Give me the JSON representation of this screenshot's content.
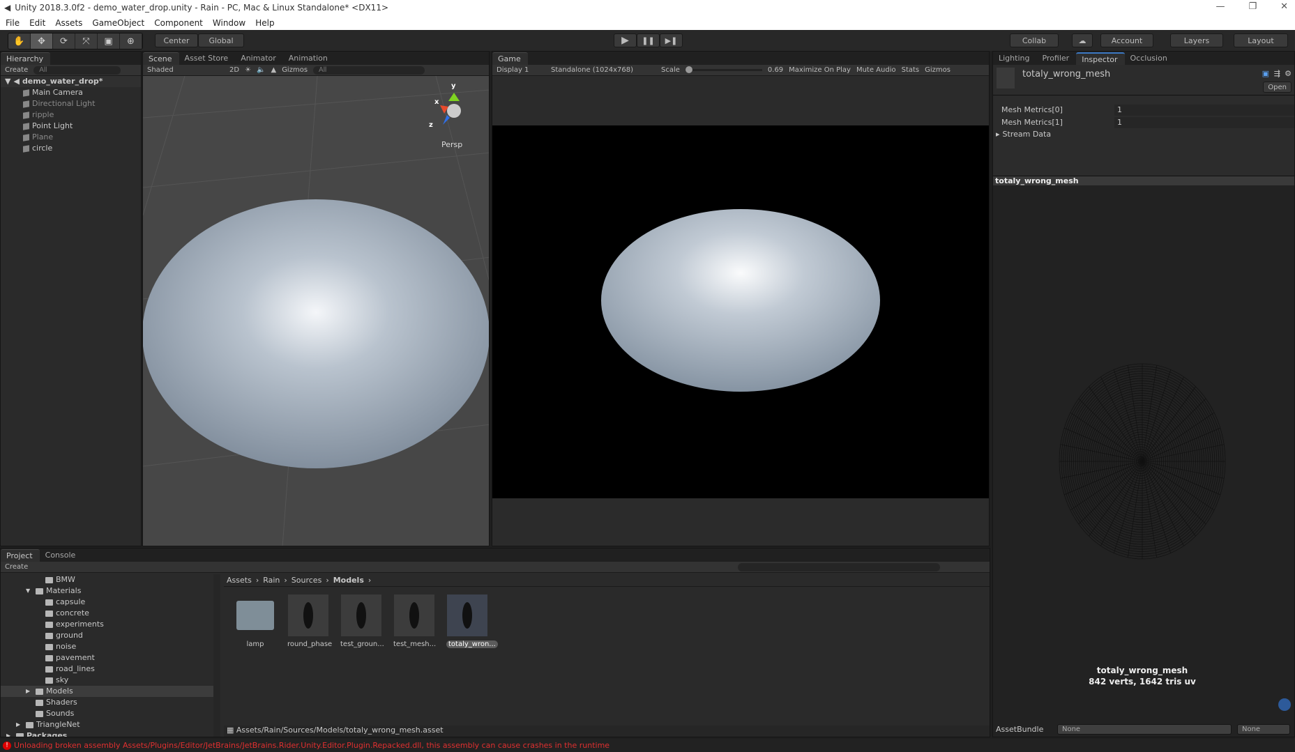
{
  "window": {
    "title": "Unity 2018.3.0f2 - demo_water_drop.unity - Rain - PC, Mac & Linux Standalone* <DX11>",
    "controls": [
      "—",
      "❐",
      "✕"
    ]
  },
  "menu": [
    "File",
    "Edit",
    "Assets",
    "GameObject",
    "Component",
    "Window",
    "Help"
  ],
  "toolbar": {
    "tools": [
      "✋",
      "✥",
      "⟳",
      "⤧",
      "▣",
      "⊕"
    ],
    "pivot": "Center",
    "space": "Global",
    "play": "▶",
    "pause": "❚❚",
    "step": "▶❚",
    "collab": "Collab",
    "account": "Account",
    "layers": "Layers",
    "layout": "Layout"
  },
  "hierarchy": {
    "tab": "Hierarchy",
    "create": "Create",
    "search_placeholder": "All",
    "scene": "demo_water_drop*",
    "items": [
      {
        "label": "Main Camera",
        "active": true
      },
      {
        "label": "Directional Light",
        "active": false
      },
      {
        "label": "ripple",
        "active": false
      },
      {
        "label": "Point Light",
        "active": true
      },
      {
        "label": "Plane",
        "active": false
      },
      {
        "label": "circle",
        "active": true
      }
    ]
  },
  "scene": {
    "tabs": [
      "Scene",
      "Asset Store",
      "Animator",
      "Animation"
    ],
    "shading": "Shaded",
    "mode2d": "2D",
    "gizmos": "Gizmos",
    "search_placeholder": "All",
    "persp": "Persp",
    "axes": {
      "x": "x",
      "y": "y",
      "z": "z"
    }
  },
  "game": {
    "tab": "Game",
    "display": "Display 1",
    "resolution": "Standalone (1024x768)",
    "scale_label": "Scale",
    "scale_value": "0.69",
    "maximize": "Maximize On Play",
    "mute": "Mute Audio",
    "stats": "Stats",
    "gizmos": "Gizmos"
  },
  "inspector": {
    "tabs": [
      "Lighting",
      "Profiler",
      "Inspector",
      "Occlusion"
    ],
    "asset_name": "totaly_wrong_mesh",
    "open": "Open",
    "fields": [
      {
        "label": "Mesh Metrics[0]",
        "value": "1"
      },
      {
        "label": "Mesh Metrics[1]",
        "value": "1"
      }
    ],
    "stream_data": "Stream Data",
    "preview_title": "totaly_wrong_mesh",
    "preview_name": "totaly_wrong_mesh",
    "preview_stats": "842 verts, 1642 tris   uv",
    "assetbundle_label": "AssetBundle",
    "assetbundle_value": "None",
    "variant_value": "None"
  },
  "project": {
    "tabs": [
      "Project",
      "Console"
    ],
    "create": "Create",
    "tree": [
      {
        "label": "BMW",
        "indent": 3
      },
      {
        "label": "Materials",
        "indent": 2,
        "expanded": true
      },
      {
        "label": "capsule",
        "indent": 3
      },
      {
        "label": "concrete",
        "indent": 3
      },
      {
        "label": "experiments",
        "indent": 3
      },
      {
        "label": "ground",
        "indent": 3
      },
      {
        "label": "noise",
        "indent": 3
      },
      {
        "label": "pavement",
        "indent": 3
      },
      {
        "label": "road_lines",
        "indent": 3
      },
      {
        "label": "sky",
        "indent": 3
      },
      {
        "label": "Models",
        "indent": 2,
        "selected": true
      },
      {
        "label": "Shaders",
        "indent": 2
      },
      {
        "label": "Sounds",
        "indent": 2
      },
      {
        "label": "TriangleNet",
        "indent": 1
      },
      {
        "label": "Packages",
        "indent": 0,
        "bold": true
      }
    ],
    "breadcrumb": [
      "Assets",
      "Rain",
      "Sources",
      "Models"
    ],
    "assets": [
      {
        "label": "lamp",
        "type": "folder"
      },
      {
        "label": "round_phase",
        "type": "mesh"
      },
      {
        "label": "test_groun...",
        "type": "mesh"
      },
      {
        "label": "test_mesh...",
        "type": "mesh"
      },
      {
        "label": "totaly_wron...",
        "type": "mesh",
        "selected": true
      }
    ],
    "path": "Assets/Rain/Sources/Models/totaly_wrong_mesh.asset"
  },
  "status": {
    "message": "Unloading broken assembly Assets/Plugins/Editor/JetBrains/JetBrains.Rider.Unity.Editor.Plugin.Repacked.dll, this assembly can cause crashes in the runtime",
    "color": "#e03030"
  }
}
